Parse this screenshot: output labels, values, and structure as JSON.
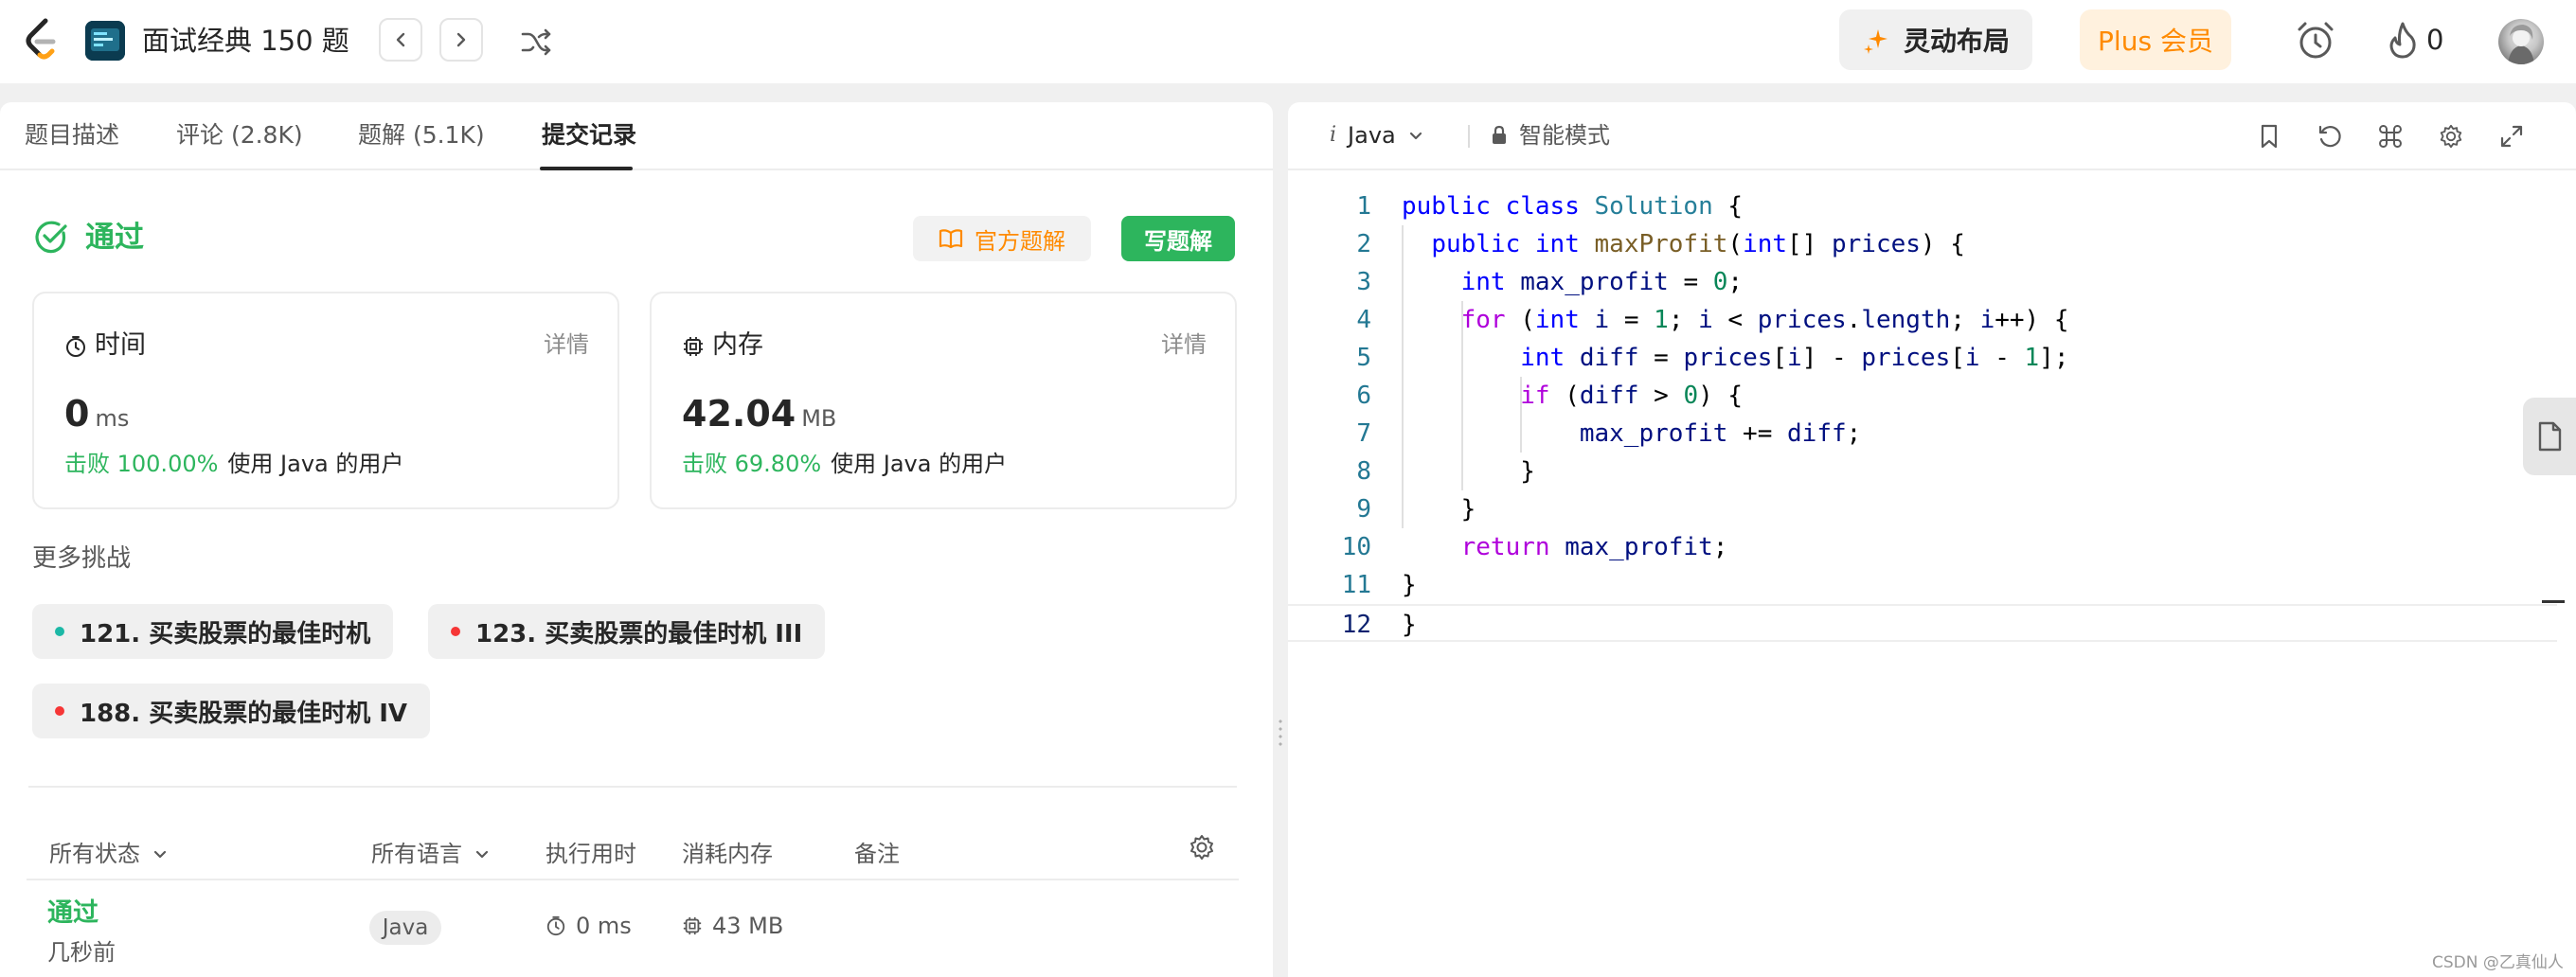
{
  "topbar": {
    "title": "面试经典 150 题",
    "layout_button": "灵动布局",
    "plus_button": "Plus 会员",
    "streak_count": "0"
  },
  "tabs": [
    {
      "label": "题目描述"
    },
    {
      "label": "评论 (2.8K)"
    },
    {
      "label": "题解 (5.1K)"
    },
    {
      "label": "提交记录",
      "active": true
    }
  ],
  "result": {
    "status": "通过",
    "official_solution_button": "官方题解",
    "write_solution_button": "写题解"
  },
  "runtime_card": {
    "label": "时间",
    "detail": "详情",
    "value": "0",
    "unit": "ms",
    "beat_percent": "击败 100.00%",
    "beat_desc": "使用 Java 的用户"
  },
  "memory_card": {
    "label": "内存",
    "detail": "详情",
    "value": "42.04",
    "unit": "MB",
    "beat_percent": "击败 69.80%",
    "beat_desc": "使用 Java 的用户"
  },
  "more_challenges": {
    "title": "更多挑战",
    "items": [
      {
        "label": "121. 买卖股票的最佳时机",
        "dot_color": "#1cb8a6"
      },
      {
        "label": "123. 买卖股票的最佳时机 III",
        "dot_color": "#f63636"
      },
      {
        "label": "188. 买卖股票的最佳时机 IV",
        "dot_color": "#f63636"
      }
    ]
  },
  "submissions": {
    "headers": {
      "status": "所有状态",
      "language": "所有语言",
      "runtime": "执行用时",
      "memory": "消耗内存",
      "notes": "备注"
    },
    "rows": [
      {
        "status": "通过",
        "time_ago": "几秒前",
        "language": "Java",
        "runtime": "0 ms",
        "memory": "43 MB"
      }
    ]
  },
  "editor": {
    "language": "Java",
    "language_prefix": "i",
    "mode": "智能模式",
    "line_numbers": [
      "1",
      "2",
      "3",
      "4",
      "5",
      "6",
      "7",
      "8",
      "9",
      "10",
      "11",
      "12"
    ]
  },
  "colors": {
    "accent_green": "#2db55d",
    "plus_orange": "#ff8a00",
    "easy_dot": "#1cb8a6",
    "hard_dot": "#f63636"
  },
  "watermark": "CSDN @乙真仙人"
}
